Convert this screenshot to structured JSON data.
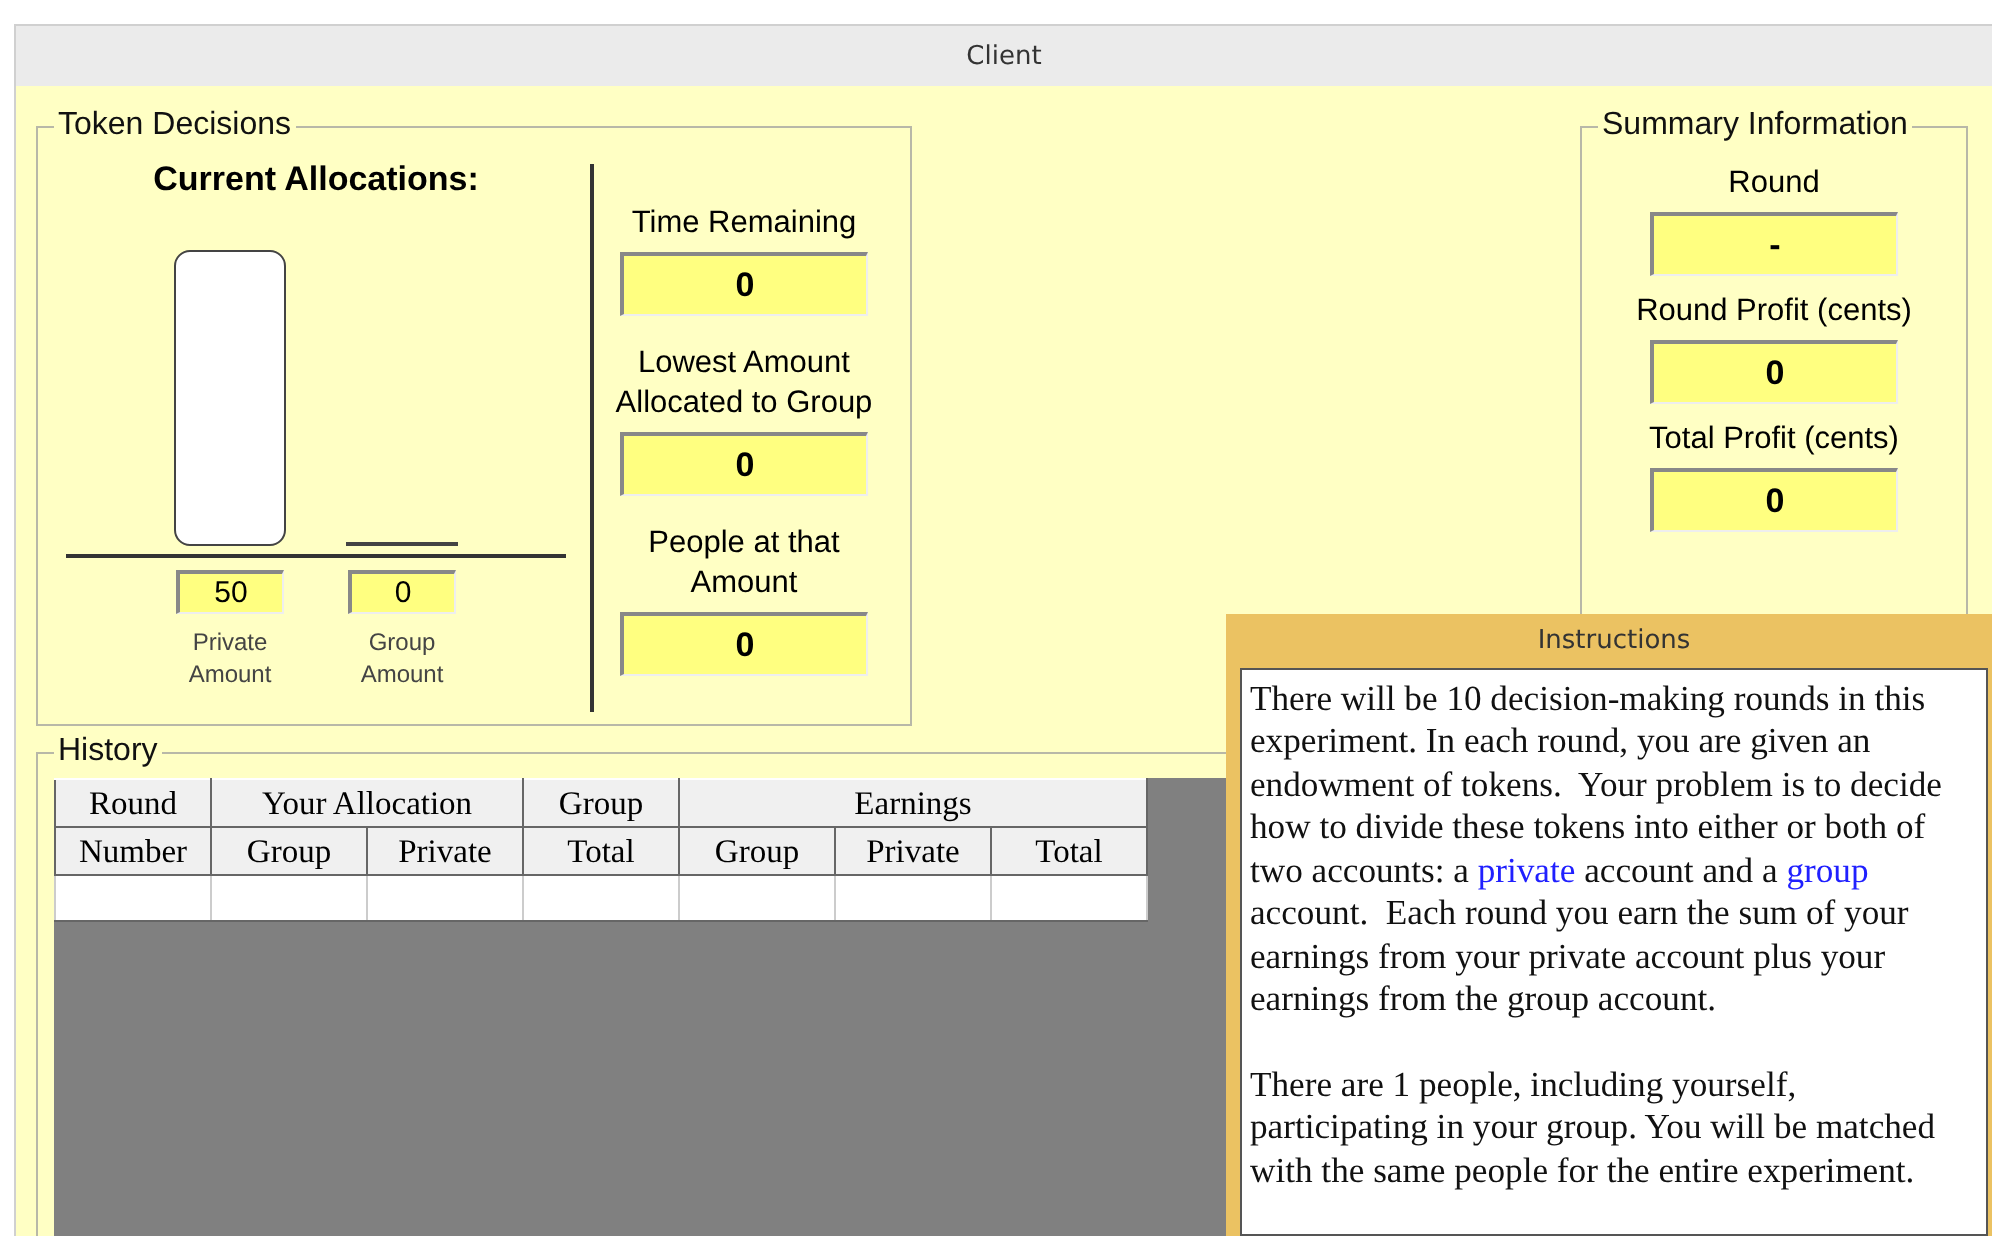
{
  "window": {
    "title": "Client"
  },
  "token_decisions": {
    "title": "Token Decisions",
    "heading": "Current Allocations:",
    "bars": [
      {
        "label": "Private Amount",
        "value": "50",
        "kind": "bar"
      },
      {
        "label": "Group Amount",
        "value": "0",
        "kind": "line"
      }
    ],
    "stats": [
      {
        "label": "Time Remaining",
        "value": "0"
      },
      {
        "label": "Lowest Amount Allocated to Group",
        "value": "0"
      },
      {
        "label": "People at that Amount",
        "value": "0"
      }
    ]
  },
  "summary": {
    "title": "Summary Information",
    "fields": [
      {
        "label": "Round",
        "value": "-"
      },
      {
        "label": "Round Profit (cents)",
        "value": "0"
      },
      {
        "label": "Total Profit (cents)",
        "value": "0"
      }
    ]
  },
  "history": {
    "title": "History",
    "column_groups": [
      {
        "label": "Round",
        "columns": [
          "Number"
        ]
      },
      {
        "label": "Your Allocation",
        "columns": [
          "Group",
          "Private"
        ]
      },
      {
        "label": "Group",
        "columns": [
          "Total"
        ]
      },
      {
        "label": "Earnings",
        "columns": [
          "Group",
          "Private",
          "Total"
        ]
      }
    ]
  },
  "instructions": {
    "title": "Instructions",
    "paragraphs": [
      [
        {
          "text": "There will be 10 decision-making rounds in this experiment. In each round, you are given an endowment of tokens.  Your problem is to decide how to divide these tokens into either or both of two accounts: a ",
          "highlighted": false
        },
        {
          "text": "private",
          "highlighted": true
        },
        {
          "text": " account and a ",
          "highlighted": false
        },
        {
          "text": "group",
          "highlighted": true
        },
        {
          "text": " account.  Each round you earn the sum of your earnings from your private account plus your earnings from the group account.",
          "highlighted": false
        }
      ],
      [
        {
          "text": "There are 1 people, including yourself, participating in your group. You will be matched with the same people for the entire experiment.",
          "highlighted": false
        }
      ]
    ]
  }
}
